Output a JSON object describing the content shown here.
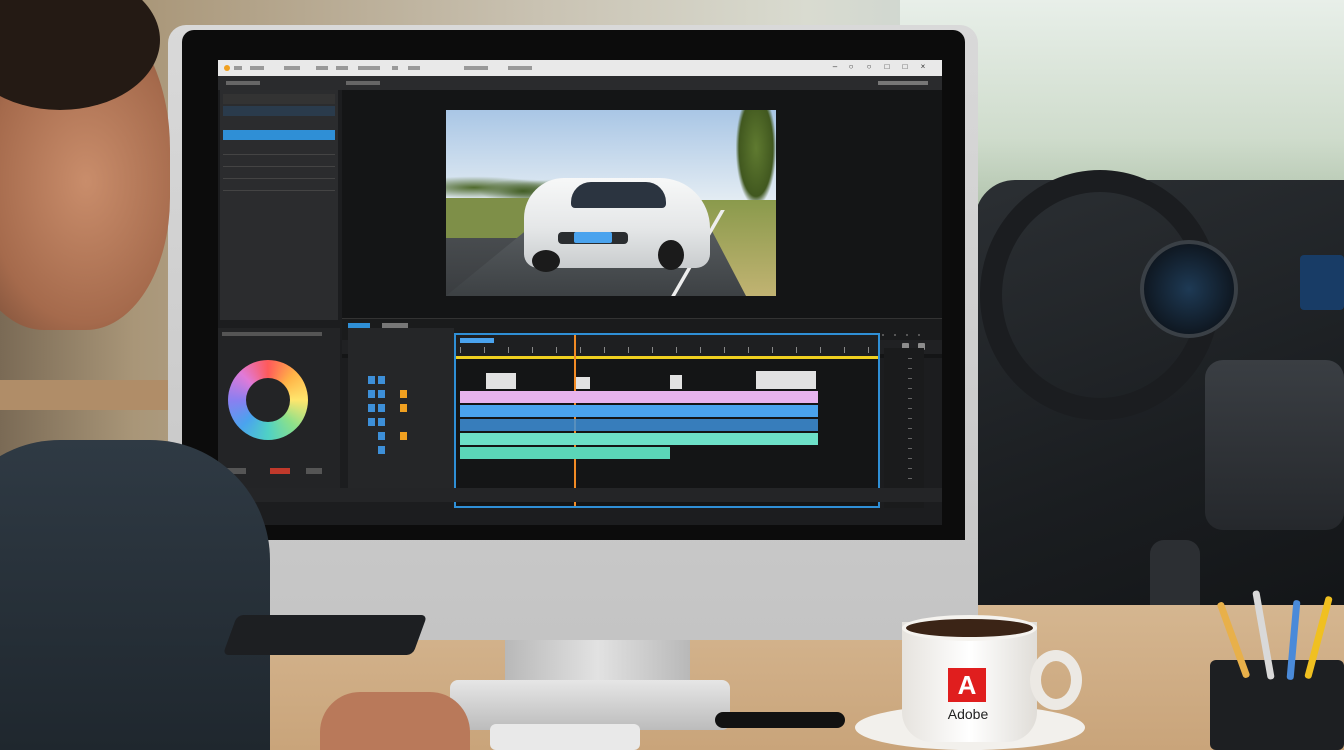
{
  "scene": {
    "mug_brand_text": "Adobe",
    "mug_logo_letter": "A",
    "apple_logo_glyph": "",
    "colors": {
      "accent_blue": "#2f8fd6",
      "playhead_orange": "#f28b25",
      "adobe_red": "#e01e1e"
    }
  },
  "app": {
    "car_plate_text": "",
    "timeline_tracks": [
      {
        "color": "#e2e2e2",
        "kind": "video-top"
      },
      {
        "color": "#e7b3ee",
        "kind": "title"
      },
      {
        "color": "#4aa3ee",
        "kind": "video"
      },
      {
        "color": "#6de0c8",
        "kind": "audio"
      }
    ]
  }
}
